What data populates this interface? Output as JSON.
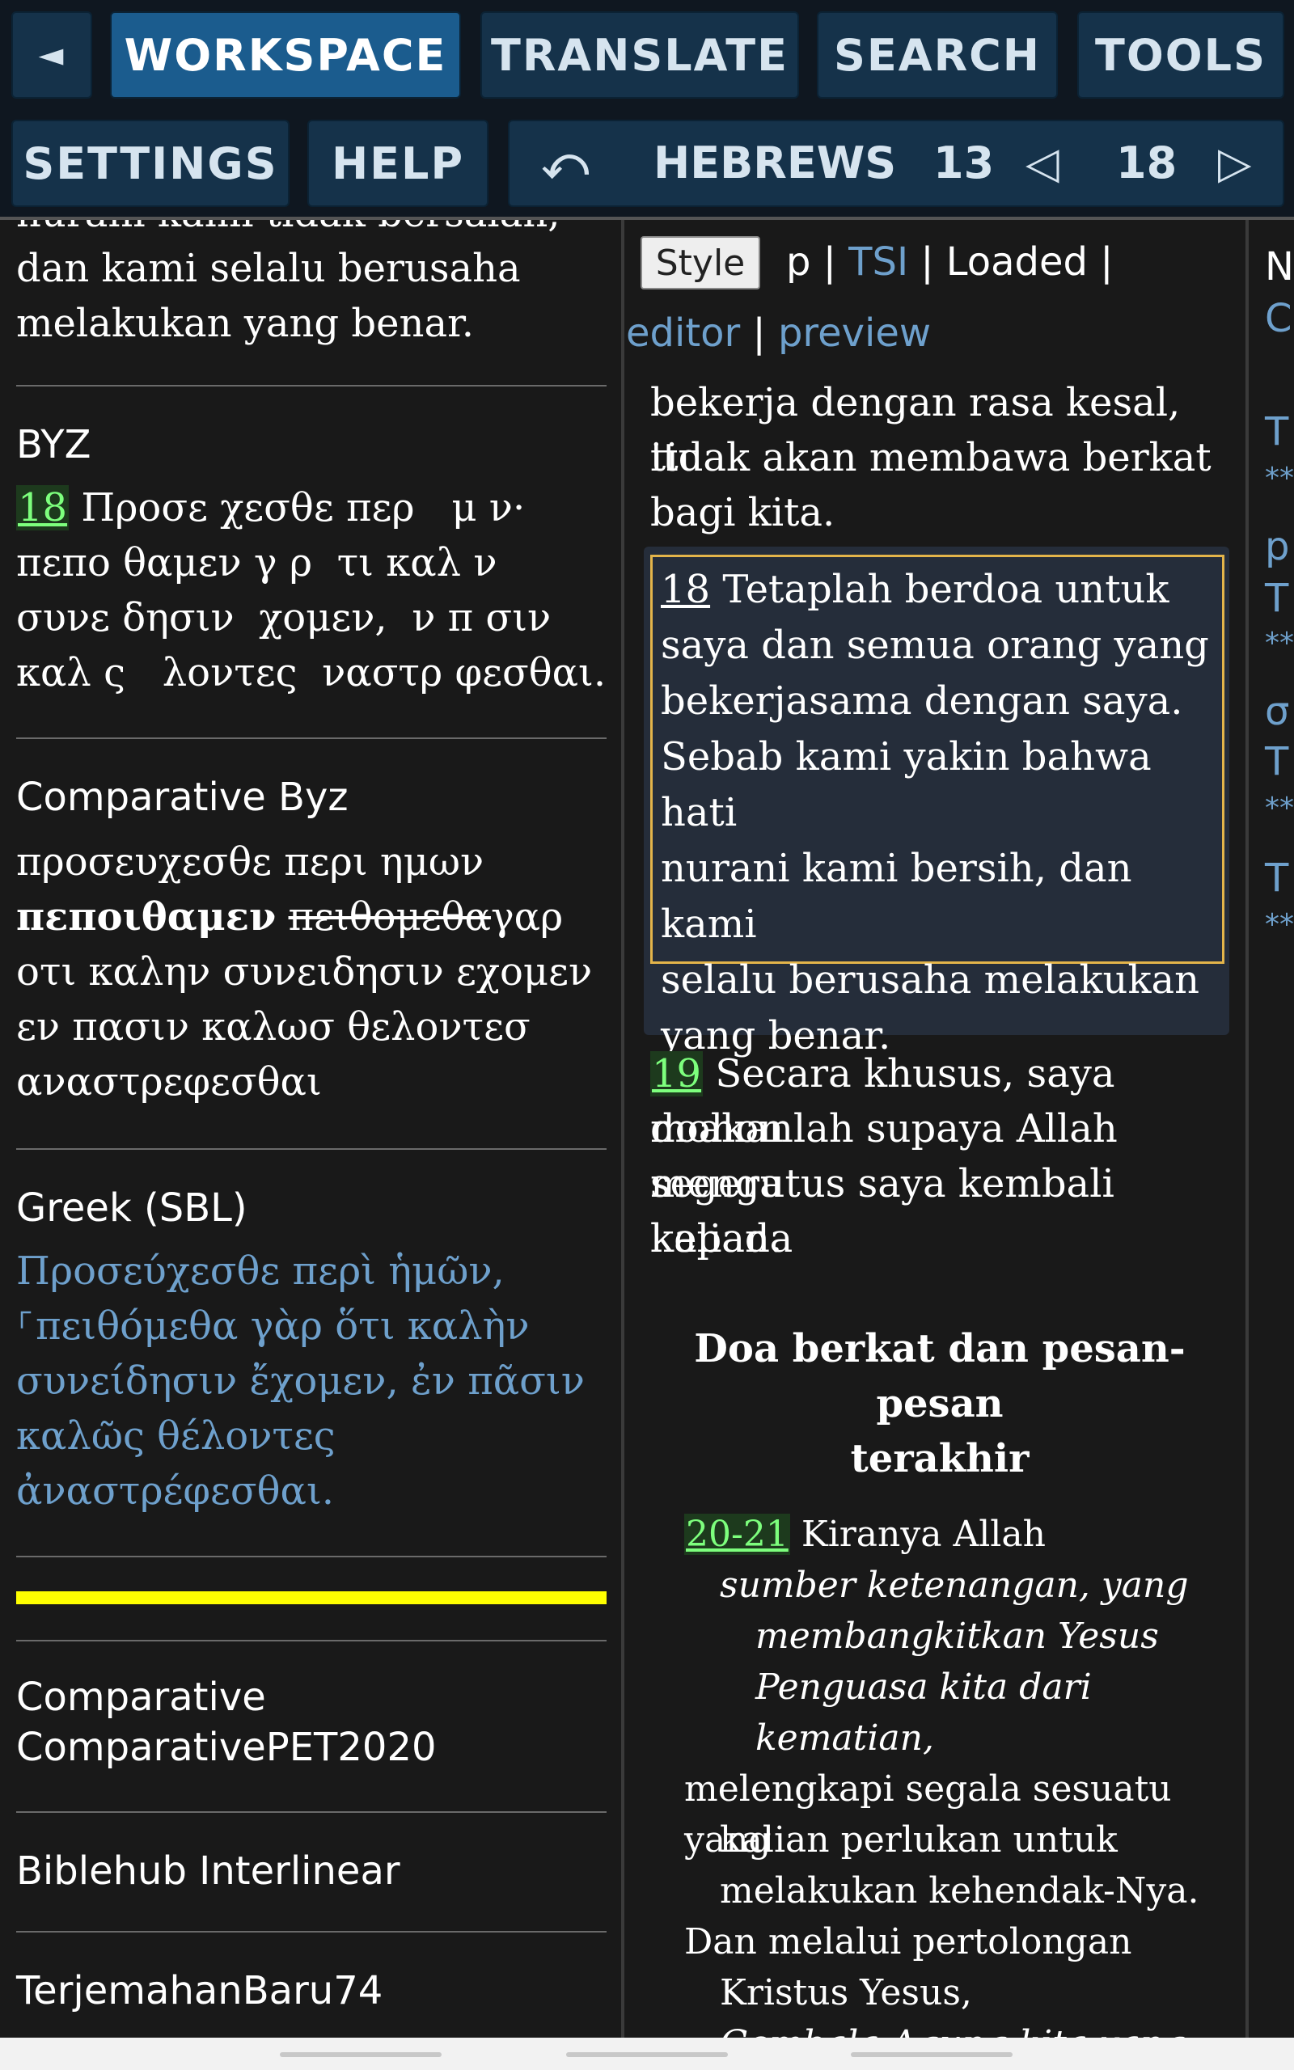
{
  "toolbar": {
    "back_glyph": "◄",
    "workspace": "WORKSPACE",
    "translate": "TRANSLATE",
    "search": "SEARCH",
    "tools": "TOOLS",
    "settings": "SETTINGS",
    "help": "HELP"
  },
  "nav": {
    "undo_glyph": "⤺",
    "book": "HEBREWS",
    "chapter": "13",
    "prev_glyph": "◁",
    "verse": "18",
    "next_glyph": "▷"
  },
  "left": {
    "top_cut": "nurani kami tidak bersalah,",
    "top_text_1": "dan kami selalu berusaha",
    "top_text_2": "melakukan yang benar.",
    "byz_label": "BYZ",
    "byz_verse_num": "18",
    "byz_line_1": " Προσε χεσθε περ   μ ν·",
    "byz_line_2": "πεπο θαμεν γ ρ  τι καλ ν",
    "byz_line_3": "συνε δησιν  χομεν,  ν π σιν",
    "byz_line_4": "καλ ς   λοντες  ναστρ φεσθαι.",
    "comp_byz_label": "Comparative Byz",
    "comp_line_1": "προσευχεσθε περι ημων",
    "comp_bold": "πεποιθαμεν",
    "comp_struck": "πειθομεθα",
    "comp_after": "γαρ",
    "comp_line_3": "οτι καλην συνειδησιν εχομεν",
    "comp_line_4": "εν πασιν καλωσ θελοντεσ",
    "comp_line_5": "αναστρεφεσθαι",
    "sbl_label": "Greek (SBL)",
    "sbl_line_1": "Προσεύχεσθε περὶ ἡμῶν,",
    "sbl_line_2": "⸀πειθόμεθα γὰρ ὅτι καλὴν",
    "sbl_line_3": "συνείδησιν ἔχομεν, ἐν πᾶσιν",
    "sbl_line_4": "καλῶς θέλοντες",
    "sbl_line_5": "ἀναστρέφεσθαι.",
    "pet_label_1": "Comparative",
    "pet_label_2": "ComparativePET2020",
    "biblehub_label": "Biblehub Interlinear",
    "tb_label": "TerjemahanBaru74"
  },
  "middle": {
    "style_btn": "Style",
    "status_p": "p",
    "status_tsi": "TSI",
    "status_loaded": "Loaded",
    "editor_link": "editor",
    "preview_link": "preview",
    "prev_line_1": "bekerja dengan rasa kesal, itu",
    "prev_line_2": "tidak akan membawa berkat",
    "prev_line_3": "bagi kita.",
    "v18_num": "18",
    "v18_line_1": " Tetaplah berdoa untuk",
    "v18_line_2": "saya dan semua orang yang",
    "v18_line_3": "bekerjasama dengan saya.",
    "v18_line_4": "Sebab kami yakin bahwa hati",
    "v18_line_5": "nurani kami bersih, dan kami",
    "v18_line_6": "selalu berusaha melakukan",
    "v18_line_7": "yang benar.",
    "v19_num": "19",
    "v19_line_1": " Secara khusus, saya mohon",
    "v19_line_2": "doakanlah supaya Allah segera",
    "v19_line_3": "mengutus saya kembali kepada",
    "v19_line_4": "kalian.",
    "heading_1": "Doa berkat dan pesan-pesan",
    "heading_2": "terakhir",
    "v20_num": "20-21",
    "v20_line_1": " Kiranya Allah",
    "p_line_1": "sumber ketenangan, yang",
    "p_line_2": "membangkitkan Yesus",
    "p_line_3": "Penguasa kita dari",
    "p_line_4": "kematian,",
    "p_line_5": "melengkapi segala sesuatu yang",
    "p_line_6": "kalian perlukan untuk",
    "p_line_7": "melakukan kehendak-Nya.",
    "p_line_8": "Dan melalui pertolongan",
    "p_line_9": "Kristus Yesus,",
    "p_line_10_cut": "Gembala Agung kita yang"
  },
  "right": {
    "r1": "N",
    "r2": "C",
    "r3": "T",
    "r4": "**",
    "r5": "p",
    "r6": "T",
    "r7": "**",
    "r8": "σ",
    "r9": "T",
    "r10": "**",
    "r11": "T",
    "r12": "**"
  },
  "colors": {
    "background": "#191919",
    "toolbar_button": "#15324a",
    "toolbar_active": "#1b5c8e",
    "link_blue": "#6ea0cc",
    "verse_green": "#7dff7d",
    "highlight_yellow": "#ffff00",
    "editor_border": "#e3b44a"
  }
}
